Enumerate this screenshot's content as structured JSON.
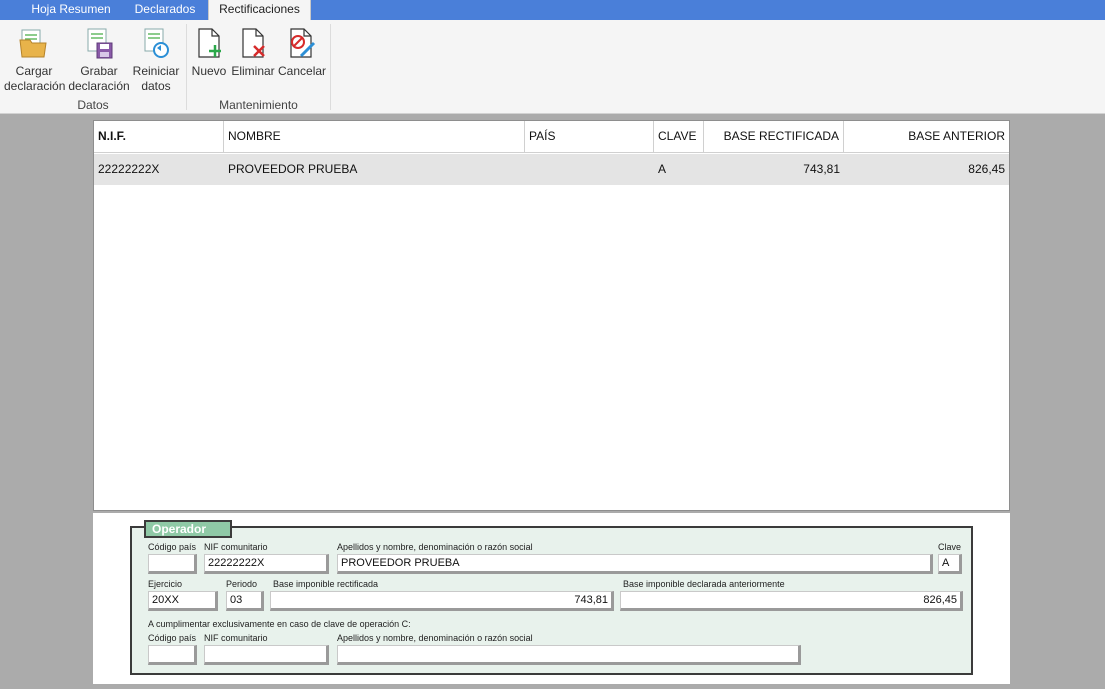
{
  "tabs": [
    {
      "label": "Hoja Resumen",
      "active": false
    },
    {
      "label": "Declarados",
      "active": false
    },
    {
      "label": "Rectificaciones",
      "active": true
    }
  ],
  "ribbon": {
    "groups": [
      {
        "label": "Datos"
      },
      {
        "label": "Mantenimiento"
      }
    ],
    "buttons": {
      "cargar": {
        "line1": "Cargar",
        "line2": "declaración",
        "icon": "folder-load-icon"
      },
      "grabar": {
        "line1": "Grabar",
        "line2": "declaración",
        "icon": "disk-save-icon"
      },
      "reiniciar": {
        "line1": "Reiniciar",
        "line2": "datos",
        "icon": "refresh-doc-icon"
      },
      "nuevo": {
        "line1": "Nuevo",
        "icon": "new-doc-icon"
      },
      "eliminar": {
        "line1": "Eliminar",
        "icon": "delete-doc-icon"
      },
      "cancelar": {
        "line1": "Cancelar",
        "icon": "cancel-doc-icon"
      }
    }
  },
  "grid": {
    "columns": [
      "N.I.F.",
      "NOMBRE",
      "PAÍS",
      "CLAVE",
      "BASE RECTIFICADA",
      "BASE ANTERIOR"
    ],
    "rows": [
      {
        "nif": "22222222X",
        "nombre": "PROVEEDOR PRUEBA",
        "pais": "",
        "clave": "A",
        "base_rectificada": "743,81",
        "base_anterior": "826,45"
      }
    ]
  },
  "operador": {
    "legend": "Operador",
    "labels": {
      "codigo_pais": "Código país",
      "nif_comunitario": "NIF comunitario",
      "apellidos": "Apellidos y nombre, denominación o razón social",
      "clave": "Clave",
      "ejercicio": "Ejercicio",
      "periodo": "Periodo",
      "base_rectificada": "Base imponible rectificada",
      "base_anterior": "Base imponible declarada anteriormente",
      "nota_c": "A cumplimentar exclusivamente en caso de clave de operación C:",
      "codigo_pais_c": "Código país",
      "nif_comunitario_c": "NIF comunitario",
      "apellidos_c": "Apellidos y nombre, denominación o razón social"
    },
    "values": {
      "codigo_pais": "",
      "nif_comunitario": "22222222X",
      "apellidos": "PROVEEDOR PRUEBA",
      "clave": "A",
      "ejercicio": "20XX",
      "periodo": "03",
      "base_rectificada": "743,81",
      "base_anterior": "826,45",
      "codigo_pais_c": "",
      "nif_comunitario_c": "",
      "apellidos_c": ""
    }
  },
  "colors": {
    "tabbar": "#4a7fd9",
    "legend": "#8fc9a6",
    "panel": "#e8f2ec"
  }
}
